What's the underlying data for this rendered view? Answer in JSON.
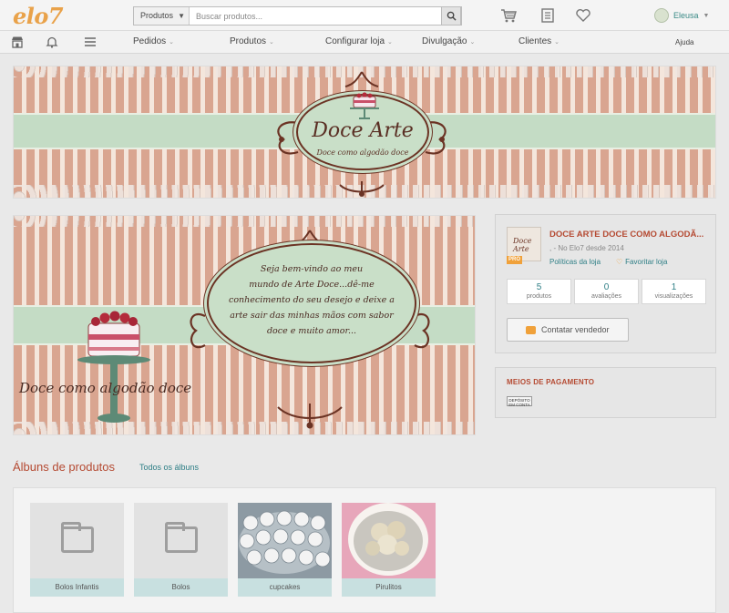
{
  "header": {
    "logo": "elo7",
    "search": {
      "category": "Produtos",
      "placeholder": "Buscar produtos..."
    },
    "user_name": "Eleusa"
  },
  "nav": {
    "items": [
      "Pedidos",
      "Produtos",
      "Configurar loja",
      "Divulgação",
      "Clientes"
    ],
    "help": "Ajuda"
  },
  "cover": {
    "title": "Doce Arte",
    "subtitle": "Doce como algodão doce"
  },
  "welcome": {
    "lines": [
      "Seja bem-vindo ao meu",
      "mundo de Arte Doce...dê-me",
      "conhecimento do seu desejo e deixe a",
      "arte sair das minhas mãos com sabor",
      "doce e muito amor..."
    ],
    "slogan": "Doce como algodão doce"
  },
  "store": {
    "name": "DOCE ARTE DOCE COMO ALGODÃ...",
    "pro_label": "PRO",
    "since": ", - No Elo7 desde 2014",
    "policies_link": "Políticas da loja",
    "favorite_link": "Favoritar loja",
    "stats": [
      {
        "value": "5",
        "label": "produtos"
      },
      {
        "value": "0",
        "label": "avaliações"
      },
      {
        "value": "1",
        "label": "visualizações"
      }
    ],
    "contact_button": "Contatar vendedor"
  },
  "payment": {
    "title": "MEIOS DE PAGAMENTO",
    "badge": "DEPÓSITO EM CONTA"
  },
  "albums": {
    "title": "Álbuns de produtos",
    "all_link": "Todos os álbuns",
    "items": [
      {
        "label": "Bolos Infantis"
      },
      {
        "label": "Bolos"
      },
      {
        "label": "cupcakes"
      },
      {
        "label": "Pirulitos"
      }
    ]
  },
  "colors": {
    "brand_orange": "#e9a24a",
    "title_red": "#b54a32",
    "link_teal": "#2f7f86",
    "banner_pink": "#d9a590",
    "banner_mint": "#c4dcc5"
  }
}
